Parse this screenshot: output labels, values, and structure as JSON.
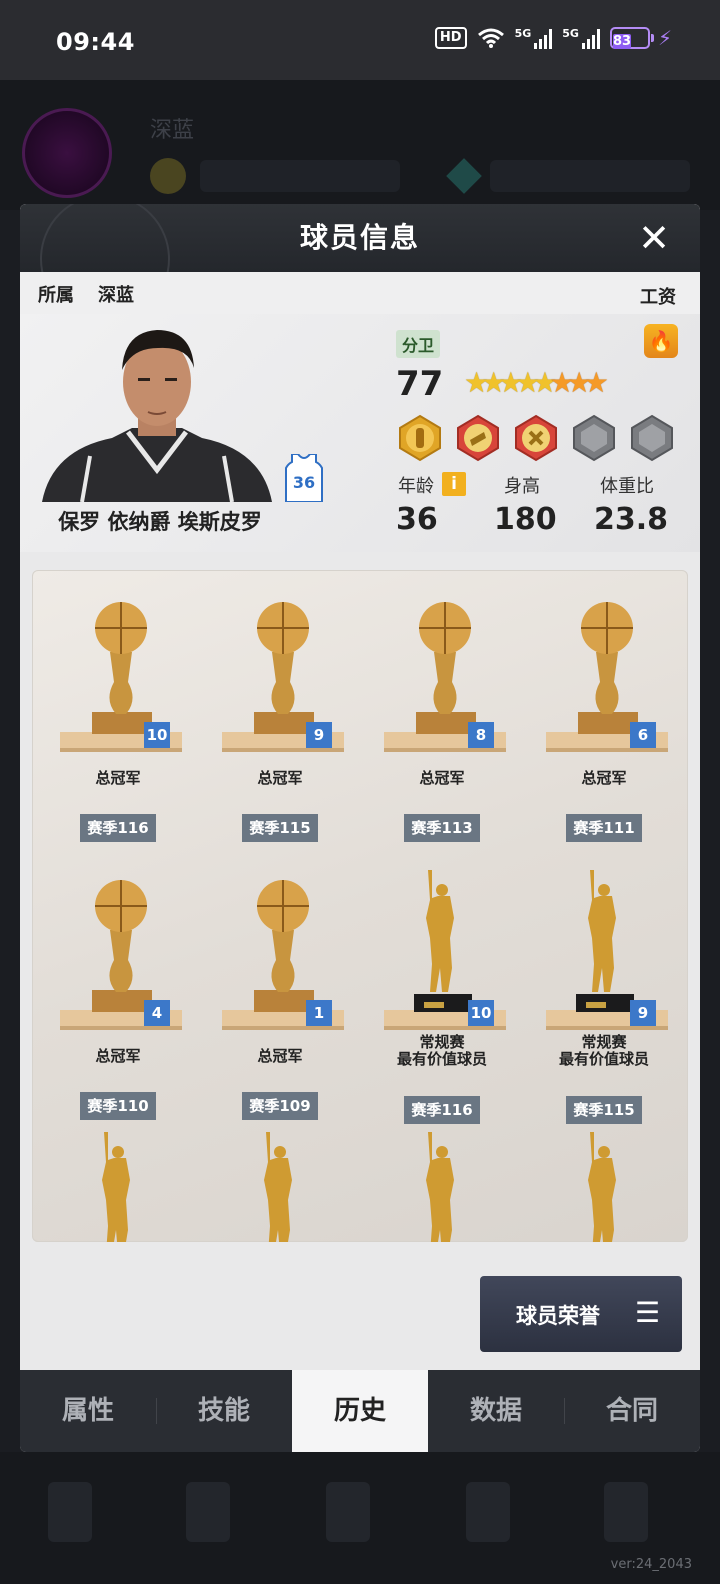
{
  "status_bar": {
    "time": "09:44",
    "hd": "HD",
    "network_1": "5G",
    "network_2": "5G",
    "battery": "83"
  },
  "background": {
    "version": "ver:24_2043"
  },
  "modal": {
    "title": "球员信息",
    "affiliation_label": "所属",
    "team": "深蓝",
    "salary_label": "工资",
    "player": {
      "name": "保罗 依纳爵 埃斯皮罗",
      "jersey_number": "36",
      "position": "分卫",
      "rating": "77",
      "stars_gold": 5,
      "stars_orange": 3,
      "age_label": "年龄",
      "age": "36",
      "height_label": "身高",
      "height": "180",
      "weight_label": "体重比",
      "weight": "23.8"
    },
    "trophies": [
      {
        "type": "champion",
        "count": "10",
        "name": "总冠军",
        "season": "赛季116"
      },
      {
        "type": "champion",
        "count": "9",
        "name": "总冠军",
        "season": "赛季115"
      },
      {
        "type": "champion",
        "count": "8",
        "name": "总冠军",
        "season": "赛季113"
      },
      {
        "type": "champion",
        "count": "6",
        "name": "总冠军",
        "season": "赛季111"
      },
      {
        "type": "champion",
        "count": "4",
        "name": "总冠军",
        "season": "赛季110"
      },
      {
        "type": "champion",
        "count": "1",
        "name": "总冠军",
        "season": "赛季109"
      },
      {
        "type": "mvp",
        "count": "10",
        "name": "常规赛",
        "name2": "最有价值球员",
        "season": "赛季116"
      },
      {
        "type": "mvp",
        "count": "9",
        "name": "常规赛",
        "name2": "最有价值球员",
        "season": "赛季115"
      }
    ],
    "honor_button": "球员荣誉",
    "tabs": [
      "属性",
      "技能",
      "历史",
      "数据",
      "合同"
    ],
    "active_tab": "历史"
  },
  "colors": {
    "accent_blue": "#3c78c9",
    "season_tag": "#6a7683",
    "fire": "#f2a020"
  }
}
